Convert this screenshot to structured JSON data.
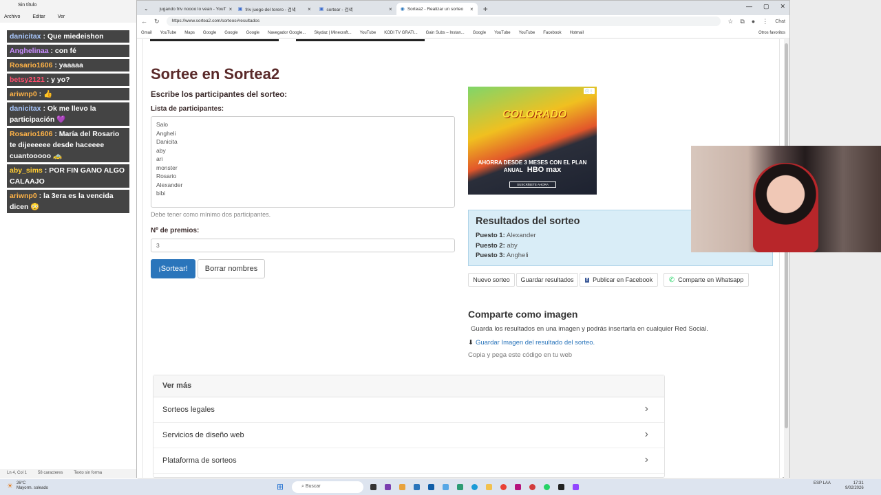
{
  "notepad": {
    "title": "Sin título",
    "menu": [
      "Archivo",
      "Editar",
      "Ver"
    ],
    "status": [
      "Ln 4, Col 1",
      "58 caracteres",
      "Texto sin forma"
    ]
  },
  "chat": [
    {
      "user": "danicitax",
      "user_color": "#a9c8ff",
      "text": ": Que miedeishon"
    },
    {
      "user": "Anghelinaa",
      "user_color": "#c98cff",
      "text": ": con fé"
    },
    {
      "user": "Rosario1606",
      "user_color": "#ffb347",
      "text": ": yaaaaa"
    },
    {
      "user": "betsy2121",
      "user_color": "#ff4d6d",
      "text": ": y yo?"
    },
    {
      "user": "ariwnp0",
      "user_color": "#ffb347",
      "text": ": 👍"
    },
    {
      "user": "danicitax",
      "user_color": "#a9c8ff",
      "text": ": Ok me llevo la participación 💜"
    },
    {
      "user": "Rosario1606",
      "user_color": "#ffb347",
      "text": ": María del Rosario te dijeeeeee desde haceeee cuantooooo 🚕"
    },
    {
      "user": "aby_sims",
      "user_color": "#ffcc33",
      "text": ": POR FIN GANO ALGO CALAAJO"
    },
    {
      "user": "ariwnp0",
      "user_color": "#ffb347",
      "text": ": la 3era es la vencida dicen 😳"
    }
  ],
  "browser": {
    "tabs": [
      {
        "label": "jugando friv noooo lo vean - YouT",
        "active": false
      },
      {
        "label": "friv juego del torero - 검색",
        "active": false
      },
      {
        "label": "sortear - 검색",
        "active": false
      },
      {
        "label": "Sortea2 - Realizar un sorteo",
        "active": true
      }
    ],
    "url": "https://www.sortea2.com/sorteos#resultados",
    "chat_label": "Chat",
    "bookmarks": [
      "Gmail",
      "YouTube",
      "Maps",
      "Google",
      "Google",
      "Google",
      "Navegador Google...",
      "Skydaz | Minecraft...",
      "YouTube",
      "KODI TV GRATI...",
      "Gain Subs – Instan...",
      "Google",
      "YouTube",
      "YouTube",
      "Facebook",
      "Hotmail"
    ],
    "other_bookmarks": "Otros favoritos"
  },
  "page": {
    "title": "Sortee en Sortea2",
    "subtitle": "Escribe los participantes del sorteo:",
    "list_label": "Lista de participantes:",
    "participants": [
      "Salo",
      "Angheli",
      "Danicita",
      "aby",
      "ari",
      "monster",
      "Rosario",
      "Alexander",
      "bibi"
    ],
    "hint": "Debe tener como mínimo dos participantes.",
    "prizes_label": "Nº de premios:",
    "prizes_value": "3",
    "sortear_label": "¡Sortear!",
    "borrar_label": "Borrar nombres",
    "ad": {
      "title": "COLORADO",
      "text": "AHORRA DESDE 3 MESES CON EL PLAN ANUAL",
      "brand": "HBO max",
      "cta": "SUSCRÍBETE AHORA"
    },
    "results": {
      "title": "Resultados del sorteo",
      "items": [
        {
          "label": "Puesto 1:",
          "name": "Alexander"
        },
        {
          "label": "Puesto 2:",
          "name": "aby"
        },
        {
          "label": "Puesto 3:",
          "name": "Angheli"
        }
      ]
    },
    "actions": [
      "Nuevo sorteo",
      "Guardar resultados",
      "Publicar en Facebook",
      "Comparte en Whatsapp"
    ],
    "share_title": "Comparte como imagen",
    "share_desc": "Guarda los resultados en una imagen y podrás insertarla en cualquier Red Social.",
    "share_link": "Guardar Imagen del resultado del sorteo.",
    "share_code": "Copia y pega este código en tu web",
    "more_title": "Ver más",
    "more_items": [
      "Sorteos legales",
      "Servicios de diseño web",
      "Plataforma de sorteos"
    ]
  },
  "taskbar": {
    "weather_temp": "26°C",
    "weather_desc": "Mayorm. soleado",
    "search": "Buscar",
    "lang": "ESP LAA",
    "time": "17:31",
    "date": "9/02/2026"
  },
  "colors": {
    "accent": "#2a75bb",
    "title": "#5a2a2a",
    "results_bg": "#d9edf7"
  }
}
